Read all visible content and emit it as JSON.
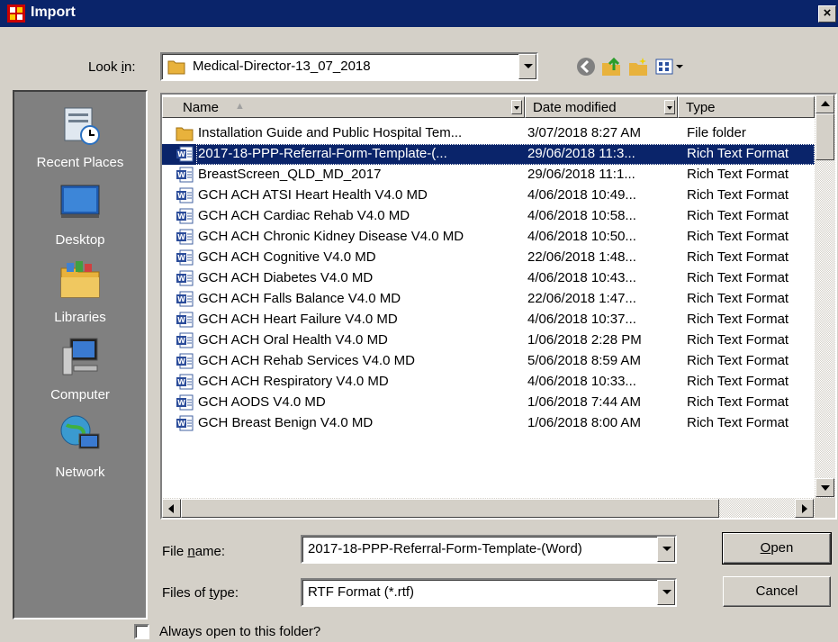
{
  "window": {
    "title": "Import",
    "close_label": "×"
  },
  "lookin": {
    "label_pre": "Look ",
    "label_key": "i",
    "label_post": "n:",
    "value": "Medical-Director-13_07_2018"
  },
  "places": [
    {
      "label": "Recent Places",
      "icon": "recent-places-icon"
    },
    {
      "label": "Desktop",
      "icon": "desktop-icon"
    },
    {
      "label": "Libraries",
      "icon": "libraries-icon"
    },
    {
      "label": "Computer",
      "icon": "computer-icon"
    },
    {
      "label": "Network",
      "icon": "network-icon"
    }
  ],
  "columns": {
    "name": "Name",
    "date": "Date modified",
    "type": "Type"
  },
  "files": [
    {
      "name": "Installation Guide and Public Hospital Tem...",
      "date": "3/07/2018 8:27 AM",
      "type": "File folder",
      "icon": "folder-icon"
    },
    {
      "name": "2017-18-PPP-Referral-Form-Template-(...",
      "date": "29/06/2018 11:3...",
      "type": "Rich Text Format",
      "icon": "word-doc-icon",
      "selected": true
    },
    {
      "name": "BreastScreen_QLD_MD_2017",
      "date": "29/06/2018 11:1...",
      "type": "Rich Text Format",
      "icon": "word-doc-icon"
    },
    {
      "name": "GCH ACH ATSI Heart Health V4.0 MD",
      "date": "4/06/2018 10:49...",
      "type": "Rich Text Format",
      "icon": "word-doc-icon"
    },
    {
      "name": "GCH ACH Cardiac Rehab V4.0 MD",
      "date": "4/06/2018 10:58...",
      "type": "Rich Text Format",
      "icon": "word-doc-icon"
    },
    {
      "name": "GCH ACH Chronic Kidney Disease V4.0 MD",
      "date": "4/06/2018 10:50...",
      "type": "Rich Text Format",
      "icon": "word-doc-icon"
    },
    {
      "name": "GCH ACH Cognitive V4.0 MD",
      "date": "22/06/2018 1:48...",
      "type": "Rich Text Format",
      "icon": "word-doc-icon"
    },
    {
      "name": "GCH ACH Diabetes V4.0 MD",
      "date": "4/06/2018 10:43...",
      "type": "Rich Text Format",
      "icon": "word-doc-icon"
    },
    {
      "name": "GCH ACH Falls Balance V4.0 MD",
      "date": "22/06/2018 1:47...",
      "type": "Rich Text Format",
      "icon": "word-doc-icon"
    },
    {
      "name": "GCH ACH Heart Failure V4.0 MD",
      "date": "4/06/2018 10:37...",
      "type": "Rich Text Format",
      "icon": "word-doc-icon"
    },
    {
      "name": "GCH ACH Oral Health V4.0 MD",
      "date": "1/06/2018 2:28 PM",
      "type": "Rich Text Format",
      "icon": "word-doc-icon"
    },
    {
      "name": "GCH ACH Rehab Services V4.0 MD",
      "date": "5/06/2018 8:59 AM",
      "type": "Rich Text Format",
      "icon": "word-doc-icon"
    },
    {
      "name": "GCH ACH Respiratory V4.0 MD",
      "date": "4/06/2018 10:33...",
      "type": "Rich Text Format",
      "icon": "word-doc-icon"
    },
    {
      "name": "GCH AODS V4.0 MD",
      "date": "1/06/2018 7:44 AM",
      "type": "Rich Text Format",
      "icon": "word-doc-icon"
    },
    {
      "name": "GCH Breast Benign V4.0 MD",
      "date": "1/06/2018 8:00 AM",
      "type": "Rich Text Format",
      "icon": "word-doc-icon"
    }
  ],
  "filename": {
    "label_pre": "File ",
    "label_key": "n",
    "label_post": "ame:",
    "value": "2017-18-PPP-Referral-Form-Template-(Word)"
  },
  "filetype": {
    "label_pre": "Files of ",
    "label_key": "t",
    "label_post": "ype:",
    "value": "RTF Format (*.rtf)"
  },
  "buttons": {
    "open_key": "O",
    "open_rest": "pen",
    "cancel": "Cancel"
  },
  "always_open": {
    "label": "Always open to this folder?",
    "checked": false
  },
  "colors": {
    "titlebar": "#0a246a",
    "selection": "#0a246a",
    "face": "#d4d0c8",
    "places_bg": "#808080"
  }
}
